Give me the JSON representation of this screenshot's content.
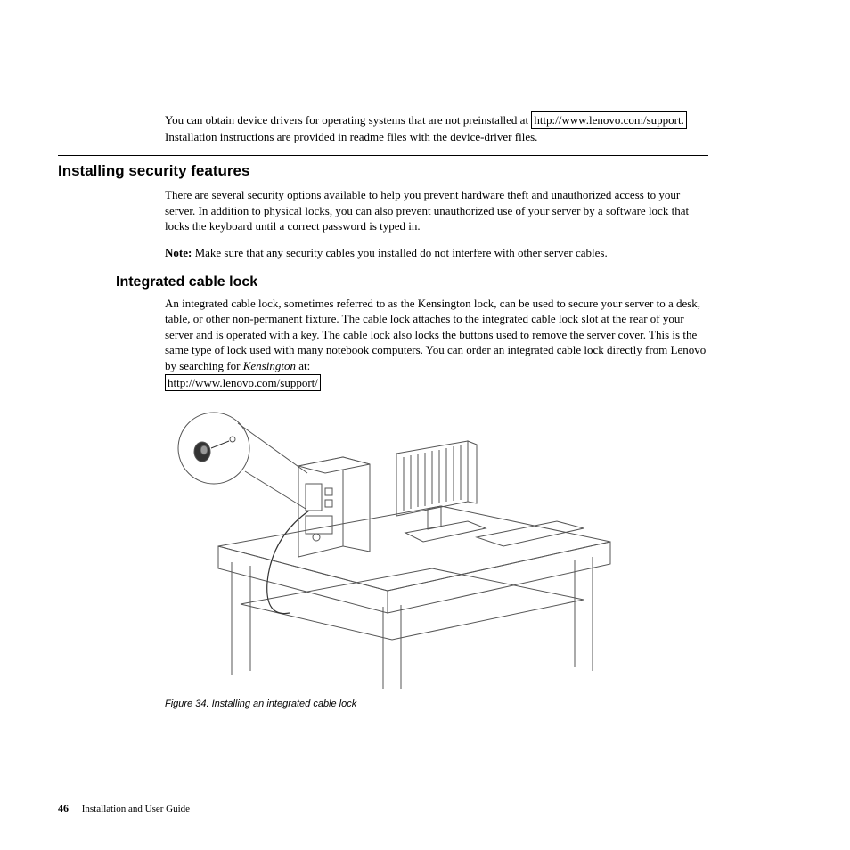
{
  "intro": {
    "p1_a": "You can obtain device drivers for operating systems that are not preinstalled at",
    "link1": "http://www.lenovo.com/support.",
    "p1_b": "Installation instructions are provided in readme files with the device-driver files."
  },
  "section1": {
    "heading": "Installing security features",
    "p1": "There are several security options available to help you prevent hardware theft and unauthorized access to your server. In addition to physical locks, you can also prevent unauthorized use of your server by a software lock that locks the keyboard until a correct password is typed in.",
    "note_label": "Note:",
    "note_text": "Make sure that any security cables you installed do not interfere with other server cables."
  },
  "section2": {
    "heading": "Integrated cable lock",
    "p1": "An integrated cable lock, sometimes referred to as the Kensington lock, can be used to secure your server to a desk, table, or other non-permanent fixture. The cable lock attaches to the integrated cable lock slot at the rear of your server and is operated with a key. The cable lock also locks the buttons used to remove the server cover. This is the same type of lock used with many notebook computers. You can order an integrated cable lock directly from Lenovo by searching for",
    "kensington": "Kensington",
    "at": " at:",
    "link": "http://www.lenovo.com/support/"
  },
  "figure": {
    "caption": "Figure 34. Installing an integrated cable lock"
  },
  "footer": {
    "page": "46",
    "title": "Installation and User Guide"
  }
}
